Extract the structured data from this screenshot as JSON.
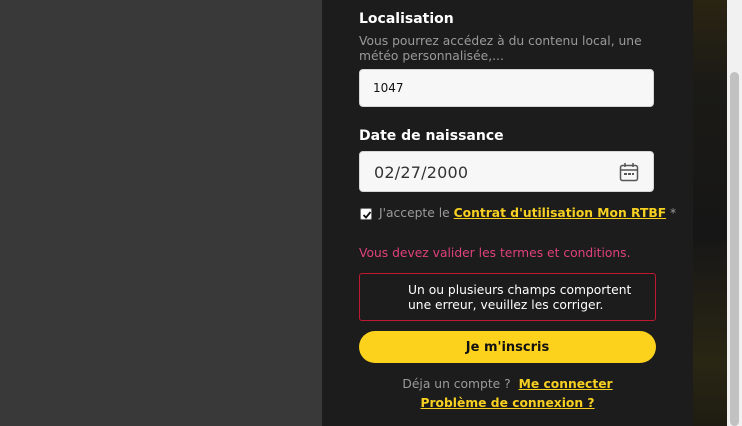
{
  "form": {
    "location": {
      "title": "Localisation",
      "help": "Vous pourrez accédez à du contenu local, une météo personnalisée,...",
      "value": "1047"
    },
    "birthdate": {
      "title": "Date de naissance",
      "value": "02/27/2000",
      "icon": "calendar-icon"
    },
    "terms": {
      "checked": true,
      "prefix": "J'accepte le",
      "link": "Contrat d'utilisation Mon RTBF",
      "required_mark": "*"
    },
    "validation_message": "Vous devez valider les termes et conditions.",
    "error_box": "Un ou plusieurs champs comportent une erreur, veuillez les corriger.",
    "submit_label": "Je m'inscris",
    "account_prompt": "Déja un compte ?",
    "login_link": "Me connecter",
    "problem_link": "Problème de connexion ?"
  },
  "colors": {
    "accent": "#fcd21c",
    "link": "#f7d021",
    "error": "#c0182f",
    "validation": "#e0417a",
    "panel": "#1c1c1c"
  }
}
